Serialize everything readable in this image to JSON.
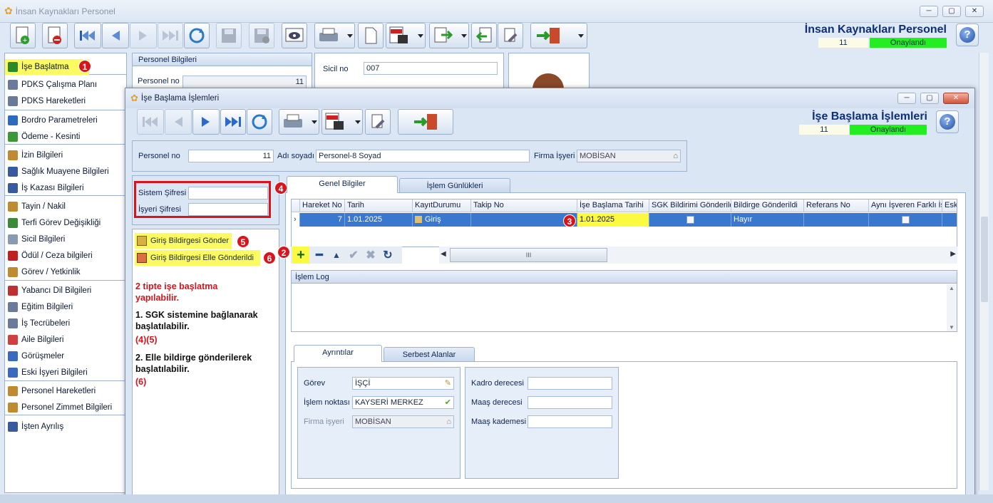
{
  "app": {
    "title": "İnsan Kaynakları Personel",
    "title_right": "İnsan Kaynakları Personel",
    "count": "11",
    "status": "Onaylandı"
  },
  "sidebar": {
    "items": [
      {
        "label": "İşe Başlatma",
        "icon": "flag-icon",
        "color": "#2a8a2a"
      },
      {
        "label": "PDKS Çalışma Planı",
        "icon": "calendar-icon",
        "color": "#6a7a9a"
      },
      {
        "label": "PDKS Hareketleri",
        "icon": "calendar-icon",
        "color": "#6a7a9a"
      },
      {
        "label": "Bordro Parametreleri",
        "icon": "ledger-icon",
        "color": "#2a6abf"
      },
      {
        "label": "Ödeme - Kesinti",
        "icon": "money-icon",
        "color": "#3a9a3a"
      },
      {
        "label": "İzin Bilgileri",
        "icon": "user-icon",
        "color": "#c08a30"
      },
      {
        "label": "Sağlık Muayene Bilgileri",
        "icon": "health-icon",
        "color": "#3a5aa0"
      },
      {
        "label": "İş Kazası Bilgileri",
        "icon": "accident-icon",
        "color": "#3a5aa0"
      },
      {
        "label": "Tayin / Nakil",
        "icon": "user-icon",
        "color": "#c08a30"
      },
      {
        "label": "Terfi Görev Değişikliği",
        "icon": "chart-icon",
        "color": "#3a8a3a"
      },
      {
        "label": "Sicil Bilgileri",
        "icon": "document-icon",
        "color": "#8a9ab0"
      },
      {
        "label": "Ödül / Ceza bilgileri",
        "icon": "award-icon",
        "color": "#c02020"
      },
      {
        "label": "Görev / Yetkinlik",
        "icon": "user-icon",
        "color": "#c08a30"
      },
      {
        "label": "Yabancı Dil Bilgileri",
        "icon": "language-icon",
        "color": "#c03030"
      },
      {
        "label": "Eğitim Bilgileri",
        "icon": "document-icon",
        "color": "#6a7a9a"
      },
      {
        "label": "İş Tecrübeleri",
        "icon": "briefcase-icon",
        "color": "#6a7a9a"
      },
      {
        "label": "Aile Bilgileri",
        "icon": "family-icon",
        "color": "#d04040"
      },
      {
        "label": "Görüşmeler",
        "icon": "meeting-icon",
        "color": "#3a6ac0"
      },
      {
        "label": "Eski İşyeri Bilgileri",
        "icon": "info-icon",
        "color": "#3a6ac0"
      },
      {
        "label": "Personel Hareketleri",
        "icon": "user-icon",
        "color": "#c08a30"
      },
      {
        "label": "Personel Zimmet Bilgileri",
        "icon": "user-icon",
        "color": "#c08a30"
      },
      {
        "label": "İşten Ayrılış",
        "icon": "exit-icon",
        "color": "#3a5aa0"
      }
    ]
  },
  "bg_panel": {
    "title": "Personel Bilgileri",
    "personel_no_label": "Personel no",
    "personel_no": "11",
    "sicil_label": "Sicil no",
    "sicil_no": "007"
  },
  "dialog": {
    "title": "İşe Başlama İşlemleri",
    "title_right": "İşe Başlama İşlemleri",
    "count": "11",
    "status": "Onaylandı",
    "personel_no_label": "Personel no",
    "personel_no": "11",
    "adi_label": "Adı soyadı",
    "adi": "Personel-8 Soyad",
    "firma_label": "Firma İşyeri",
    "firma": "MOBİSAN",
    "sistem_sifresi_label": "Sistem Şifresi",
    "isyeri_sifresi_label": "İşyeri Şifresi",
    "btn_gonder": "Giriş Bildirgesi Gönder",
    "btn_elle": "Giriş Bildirgesi Elle Gönderildi",
    "note_title": "2 tipte işe başlatma yapılabilir.",
    "note_1": "1. SGK sistemine bağlanarak başlatılabilir.",
    "note_1_ref": "(4)(5)",
    "note_2": "2. Elle bildirge gönderilerek başlatılabilir.",
    "note_2_ref": "(6)",
    "tabs": [
      "Genel Bilgiler",
      "İşlem Günlükleri"
    ],
    "grid": {
      "headers": [
        "Hareket No",
        "Tarih",
        "KayıtDurumu",
        "Takip No",
        "İşe Başlama Tarihi",
        "SGK Bildirimi Gönderildi",
        "Bildirge Gönderildi",
        "Referans No",
        "Aynı İşveren Farklı İş",
        "Eski"
      ],
      "row": {
        "hareket_no": "7",
        "tarih": "1.01.2025",
        "kayit": "Giriş",
        "takip": "",
        "ise_baslama": "1.01.2025",
        "bildirge": "Hayır"
      }
    },
    "islem_log": "İşlem Log",
    "sub_tabs": [
      "Ayrıntılar",
      "Serbest Alanlar"
    ],
    "gorev_label": "Görev",
    "gorev": "İŞÇİ",
    "islem_label": "İşlem noktası",
    "islem": "KAYSERİ MERKEZ",
    "firma_isyeri_label": "Firma işyeri",
    "firma_isyeri": "MOBİSAN",
    "kadro_label": "Kadro derecesi",
    "maas_der_label": "Maaş derecesi",
    "maas_kad_label": "Maaş kademesi",
    "scroll_mark": "III"
  },
  "badges": [
    "1",
    "2",
    "3",
    "4",
    "5",
    "6"
  ]
}
